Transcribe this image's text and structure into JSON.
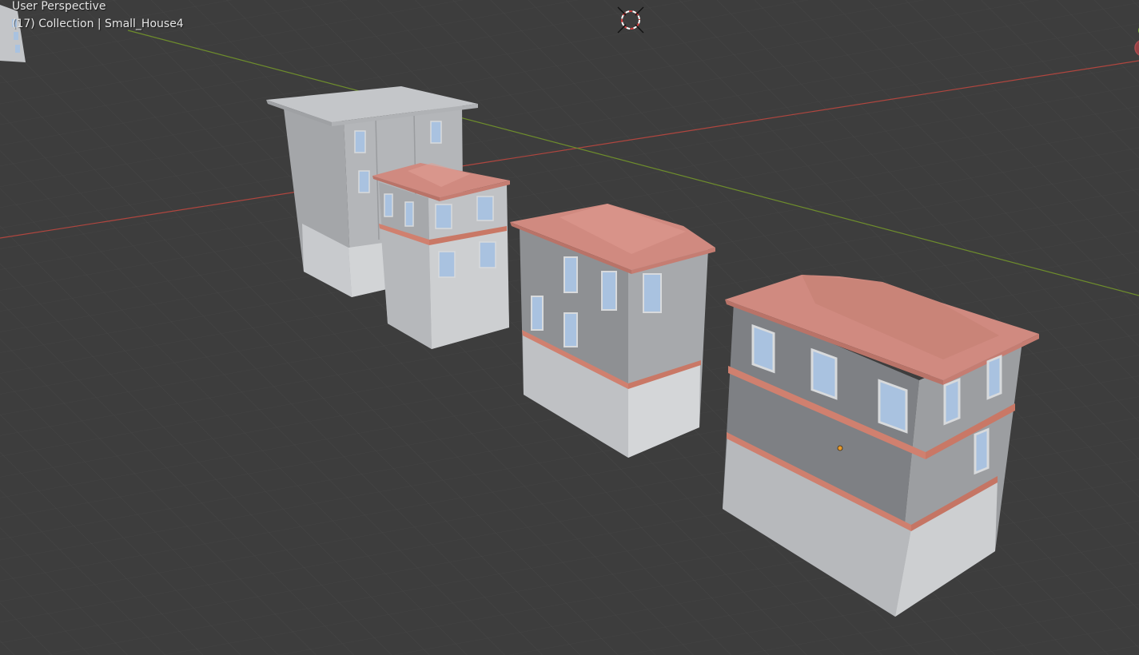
{
  "viewport": {
    "view_name": "User Perspective",
    "collection_label": "(17) Collection | Small_House4",
    "background_color": "#3d3d3d",
    "grid_color": "#484848",
    "x_axis_color": "#b0463f",
    "y_axis_color": "#6e8d2c"
  },
  "scene": {
    "objects": [
      {
        "name": "tall-house"
      },
      {
        "name": "small-tower-house"
      },
      {
        "name": "medium-house"
      },
      {
        "name": "Small_House4",
        "selected": true
      }
    ],
    "colors": {
      "wall_light": "#c3c5c8",
      "wall_mid": "#a8aaad",
      "wall_dark": "#86888b",
      "roof": "#d08a80",
      "roof_shade": "#b97368",
      "trim": "#d0806f",
      "window": "#a9c2e0",
      "origin_dot": "#e89a2c"
    }
  },
  "icons": {
    "cursor": "3d-cursor-icon",
    "gizmo": "navigation-gizmo-icon"
  }
}
